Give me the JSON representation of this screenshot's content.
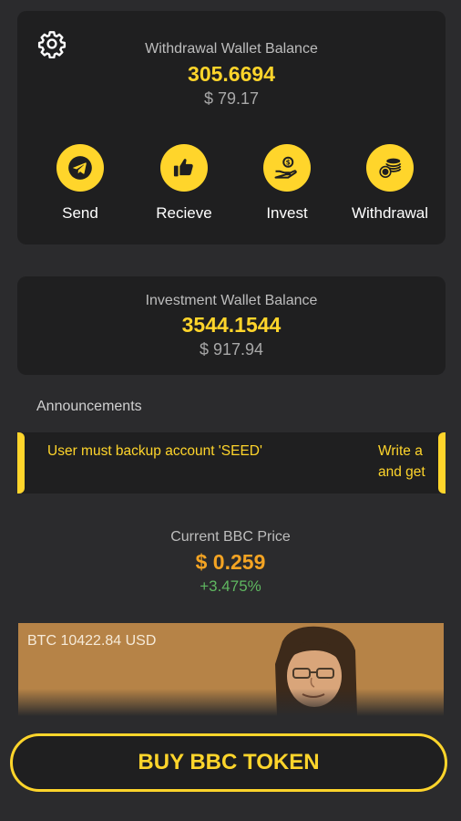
{
  "withdrawal_wallet": {
    "title": "Withdrawal Wallet Balance",
    "amount": "305.6694",
    "usd": "$ 79.17"
  },
  "actions": [
    {
      "label": "Send",
      "icon": "telegram-send-icon"
    },
    {
      "label": "Recieve",
      "icon": "thumbs-up-icon"
    },
    {
      "label": "Invest",
      "icon": "hand-coin-icon"
    },
    {
      "label": "Withdrawal",
      "icon": "coin-stack-icon"
    }
  ],
  "investment_wallet": {
    "title": "Investment Wallet Balance",
    "amount": "3544.1544",
    "usd": "$ 917.94"
  },
  "announcements": {
    "label": "Announcements",
    "message_1": "User must backup account 'SEED'",
    "message_2_line1": "Write a",
    "message_2_line2": "and get"
  },
  "price": {
    "title": "Current BBC Price",
    "value": "$ 0.259",
    "change": "+3.475%"
  },
  "btc_banner": {
    "text": "BTC 10422.84 USD"
  },
  "buy_button": {
    "label": "BUY BBC TOKEN"
  },
  "colors": {
    "background": "#2b2b2d",
    "card": "#1f1f20",
    "accent_yellow": "#ffd52b",
    "price_orange": "#f4a423",
    "positive_green": "#5fb760"
  }
}
